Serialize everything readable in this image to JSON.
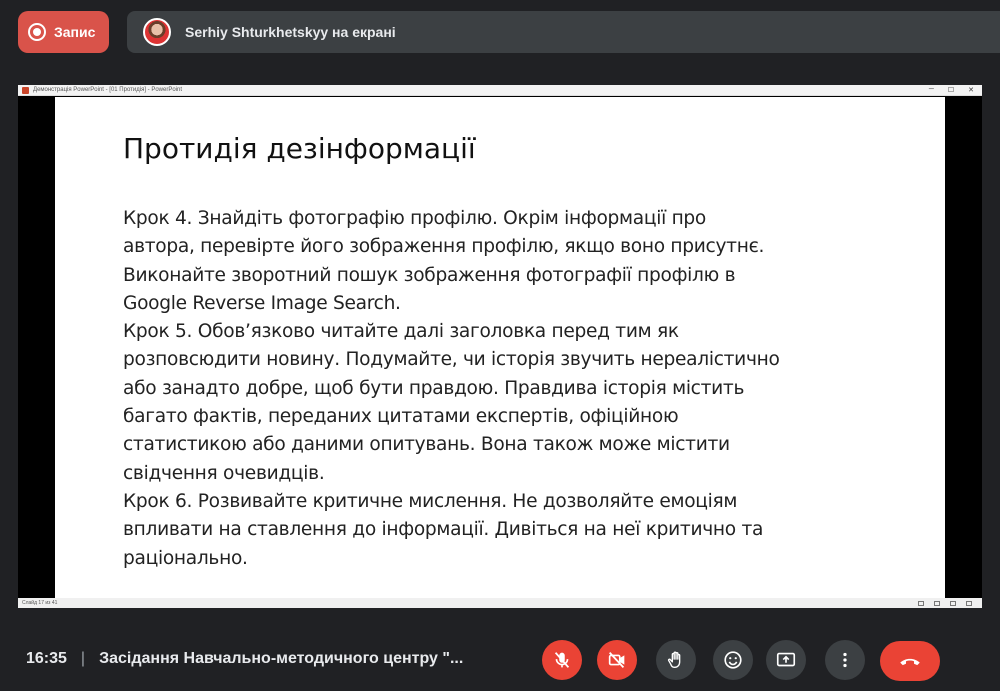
{
  "top_bar": {
    "record_label": "Запис",
    "presenter_text": "Serhiy Shturkhetskyy на екрані"
  },
  "window": {
    "title": "Демонстрація PowerPoint - [01 Протидія] - PowerPoint",
    "status_text": "Слайд 17 из 41"
  },
  "slide": {
    "title": "Протидія дезінформації",
    "lines": [
      "Крок 4. Знайдіть фотографію профілю. Окрім інформації про",
      "автора, перевірте його зображення профілю, якщо воно присутнє.",
      "Виконайте зворотний пошук зображення фотографії профілю в",
      "Google Reverse Image Search.",
      "Крок 5. Обов’язково читайте далі заголовка перед тим як",
      "розповсюдити новину. Подумайте, чи історія звучить нереалістично",
      "або занадто добре, щоб бути правдою. Правдива історія містить",
      "багато фактів, переданих цитатами експертів, офіційною",
      "статистикою або даними опитувань. Вона також може містити",
      "свідчення очевидців.",
      "Крок 6. Розвивайте критичне мислення. Не дозволяйте емоціям",
      "впливати на ставлення до інформації. Дивіться на неї критично та",
      "раціонально."
    ]
  },
  "bottom_bar": {
    "time": "16:35",
    "separator": "|",
    "meeting_title": "Засідання Навчально-методичного центру \"..."
  },
  "controls": [
    {
      "name": "mic-off-icon",
      "state": "off"
    },
    {
      "name": "camera-off-icon",
      "state": "off"
    },
    {
      "name": "raise-hand-icon",
      "state": "normal"
    },
    {
      "name": "emoji-icon",
      "state": "normal"
    },
    {
      "name": "present-icon",
      "state": "normal"
    },
    {
      "name": "more-options-icon",
      "state": "normal"
    },
    {
      "name": "end-call-icon",
      "state": "danger"
    }
  ],
  "colors": {
    "background": "#202124",
    "record": "#d9534a",
    "danger": "#ea4335",
    "control_gray": "#3c4043"
  }
}
